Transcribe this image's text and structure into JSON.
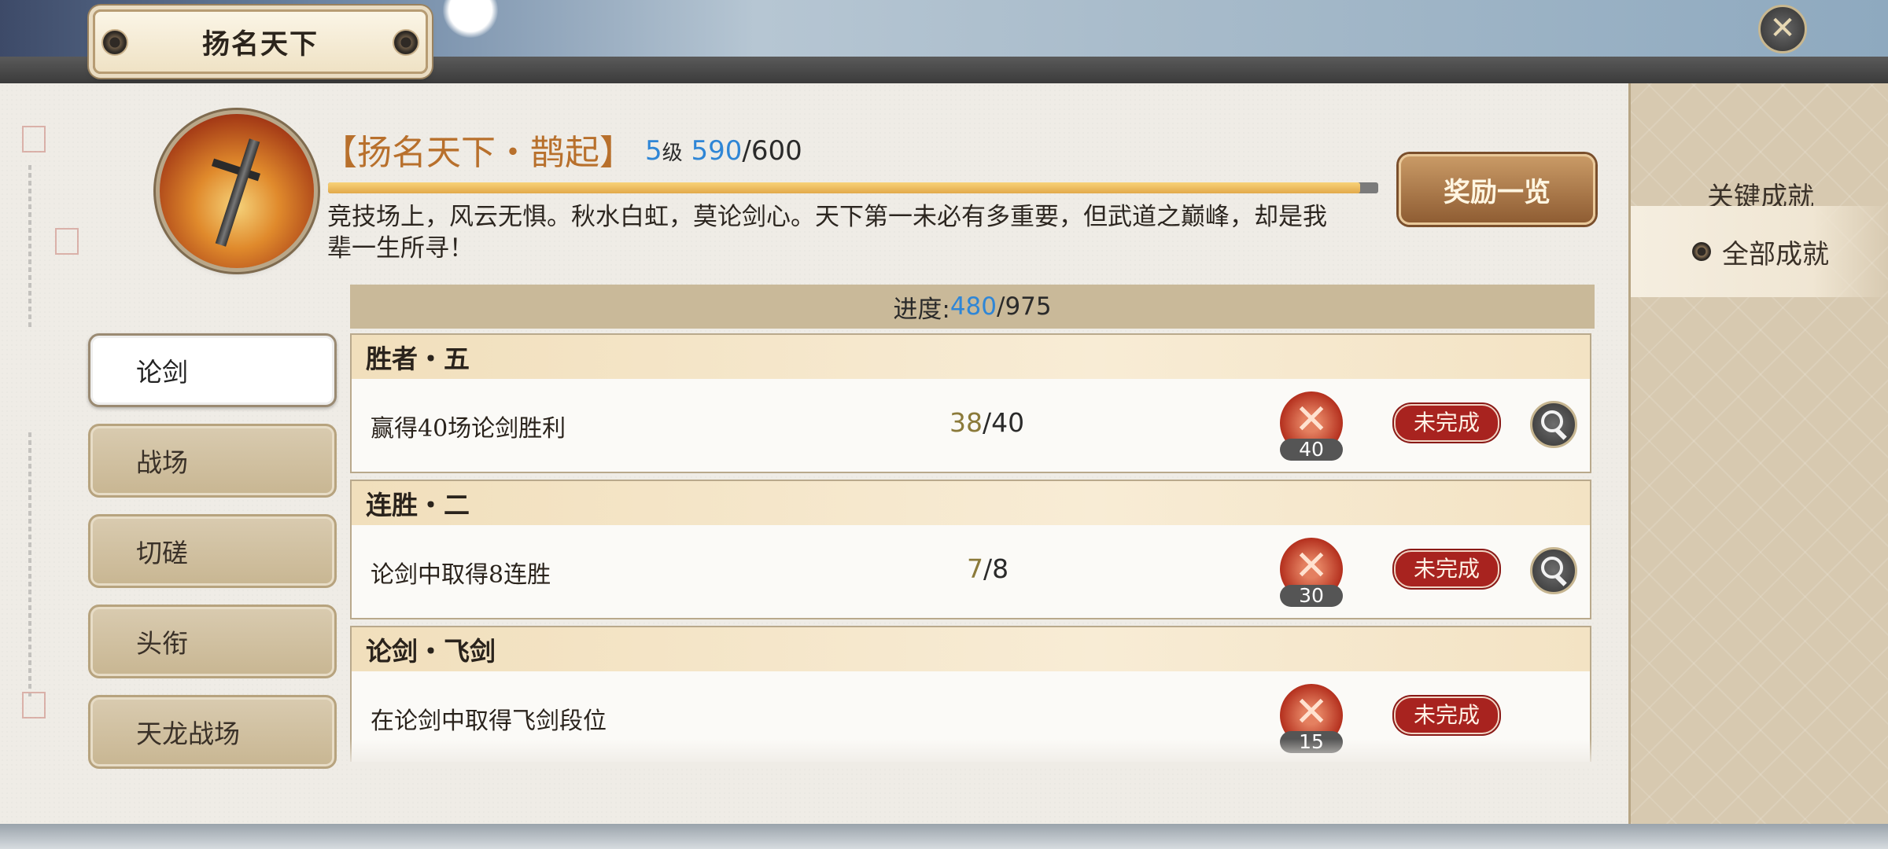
{
  "window": {
    "title": "扬名天下"
  },
  "achievement": {
    "title": "【扬名天下・鹊起】",
    "level": "5",
    "level_unit": "级",
    "xp_current": "590",
    "xp_total": "/600",
    "xp_fraction": 0.983,
    "description": "竞技场上，风云无惧。秋水白虹，莫论剑心。天下第一未必有多重要，但武道之巅峰，却是我辈一生所寻！"
  },
  "reward_button": "奖励一览",
  "progress": {
    "label": "进度:",
    "current": "480",
    "total": "/975"
  },
  "left_tabs": [
    "论剑",
    "战场",
    "切磋",
    "头衔",
    "天龙战场"
  ],
  "active_left_tab": "论剑",
  "right_tabs": [
    "关键成就",
    "全部成就"
  ],
  "active_right_tab": "全部成就",
  "items": [
    {
      "name": "胜者・五",
      "desc": "赢得40场论剑胜利",
      "current": "38",
      "total": "/40",
      "reward": "40",
      "status": "未完成",
      "has_search": true
    },
    {
      "name": "连胜・二",
      "desc": "论剑中取得8连胜",
      "current": "7",
      "total": "/8",
      "reward": "30",
      "status": "未完成",
      "has_search": true
    },
    {
      "name": "论剑・飞剑",
      "desc": "在论剑中取得飞剑段位",
      "current": "",
      "total": "",
      "reward": "15",
      "status": "未完成",
      "has_search": false
    }
  ],
  "colors": {
    "accent_blue": "#2f86d6",
    "title_orange": "#b8702c",
    "status_red": "#a8231f"
  }
}
